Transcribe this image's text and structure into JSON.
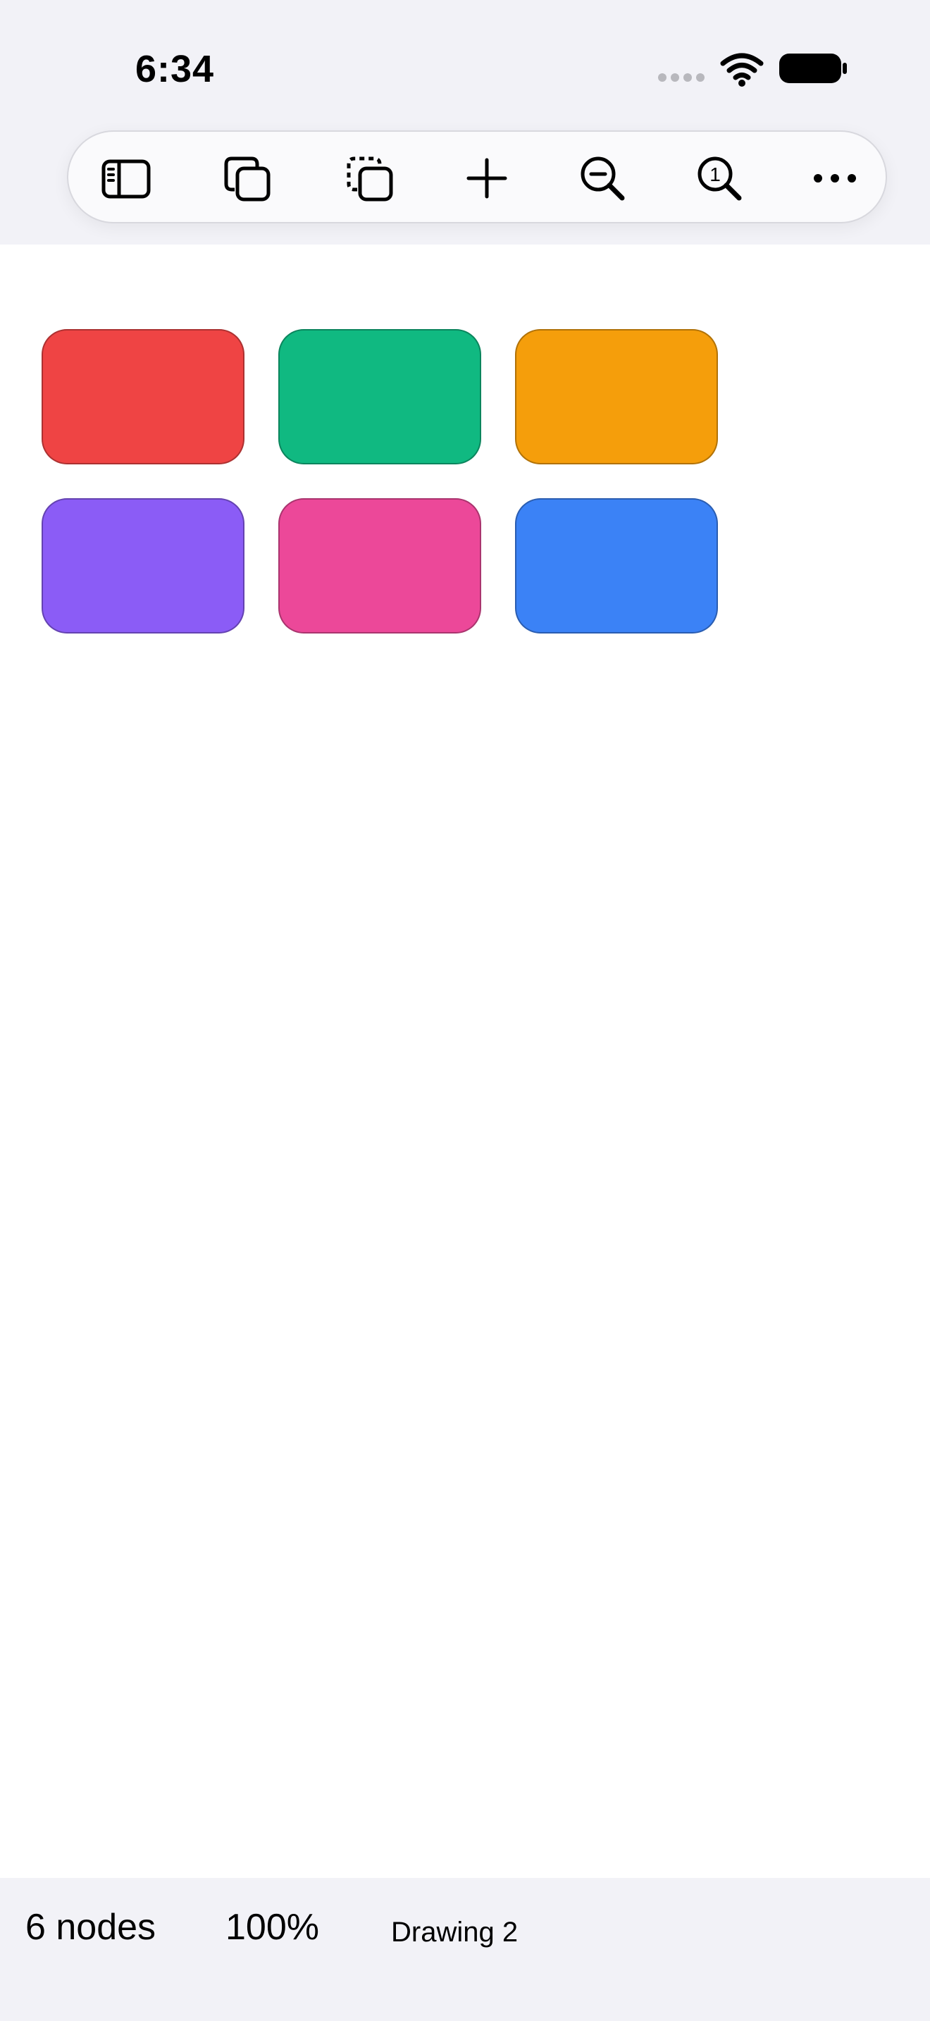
{
  "status_bar": {
    "time": "6:34",
    "icons": [
      "signal-dots-icon",
      "wifi-icon",
      "battery-icon"
    ]
  },
  "toolbar": {
    "buttons": [
      {
        "name": "sidebar-toggle",
        "icon": "sidebar-icon"
      },
      {
        "name": "duplicate",
        "icon": "duplicate-icon"
      },
      {
        "name": "duplicate-dashed",
        "icon": "duplicate-dashed-icon"
      },
      {
        "name": "add",
        "icon": "plus-icon"
      },
      {
        "name": "zoom-out",
        "icon": "zoom-out-icon"
      },
      {
        "name": "actual-size",
        "icon": "zoom-actual-size-icon",
        "glyph": "1"
      },
      {
        "name": "more",
        "icon": "ellipsis-icon"
      }
    ]
  },
  "canvas": {
    "nodes": [
      {
        "color": "#ef4444"
      },
      {
        "color": "#10b981"
      },
      {
        "color": "#f59e0b"
      },
      {
        "color": "#8b5cf6"
      },
      {
        "color": "#ec4899"
      },
      {
        "color": "#3b82f6"
      }
    ]
  },
  "bottom_bar": {
    "node_count": "6 nodes",
    "zoom": "100%",
    "document_title": "Drawing 2"
  },
  "colors": {
    "chrome_background": "#f2f2f7",
    "canvas_background": "#ffffff",
    "toolbar_background": "#fafafc"
  }
}
